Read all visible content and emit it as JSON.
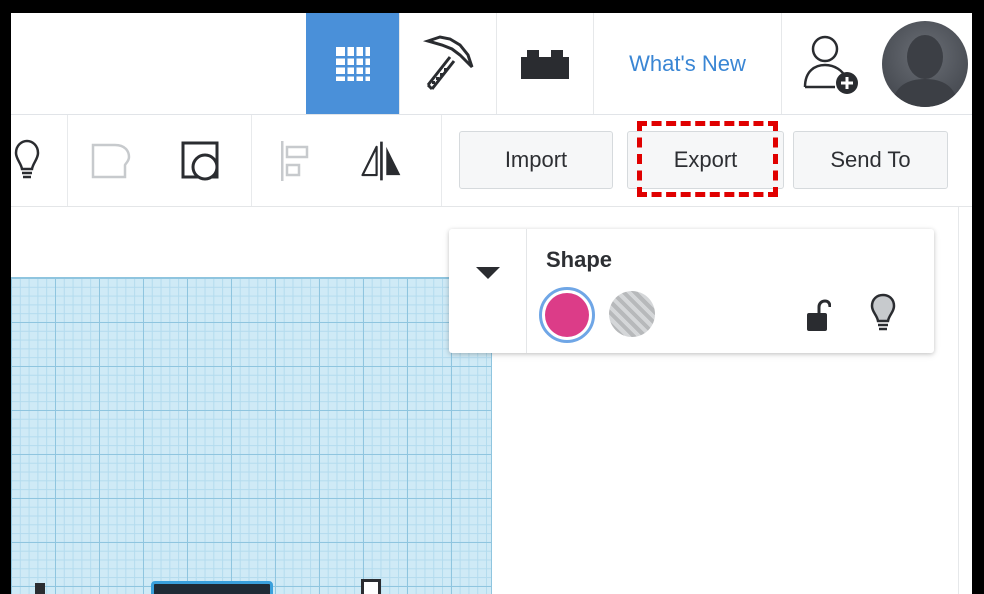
{
  "header": {
    "whats_new_label": "What's New"
  },
  "icons": {
    "grid_view": "grid-icon",
    "blocks_view": "pickaxe-icon",
    "bricks_view": "brick-icon",
    "add_user": "add-user-icon",
    "avatar": "user-avatar"
  },
  "toolbar": {
    "import_label": "Import",
    "export_label": "Export",
    "send_to_label": "Send To"
  },
  "shape_panel": {
    "title": "Shape",
    "solid_color": "#dc3c88"
  },
  "colors": {
    "accent": "#4a90d9",
    "link": "#3a86d4",
    "highlight": "#e00000",
    "workplane": "#cfeaf6"
  }
}
